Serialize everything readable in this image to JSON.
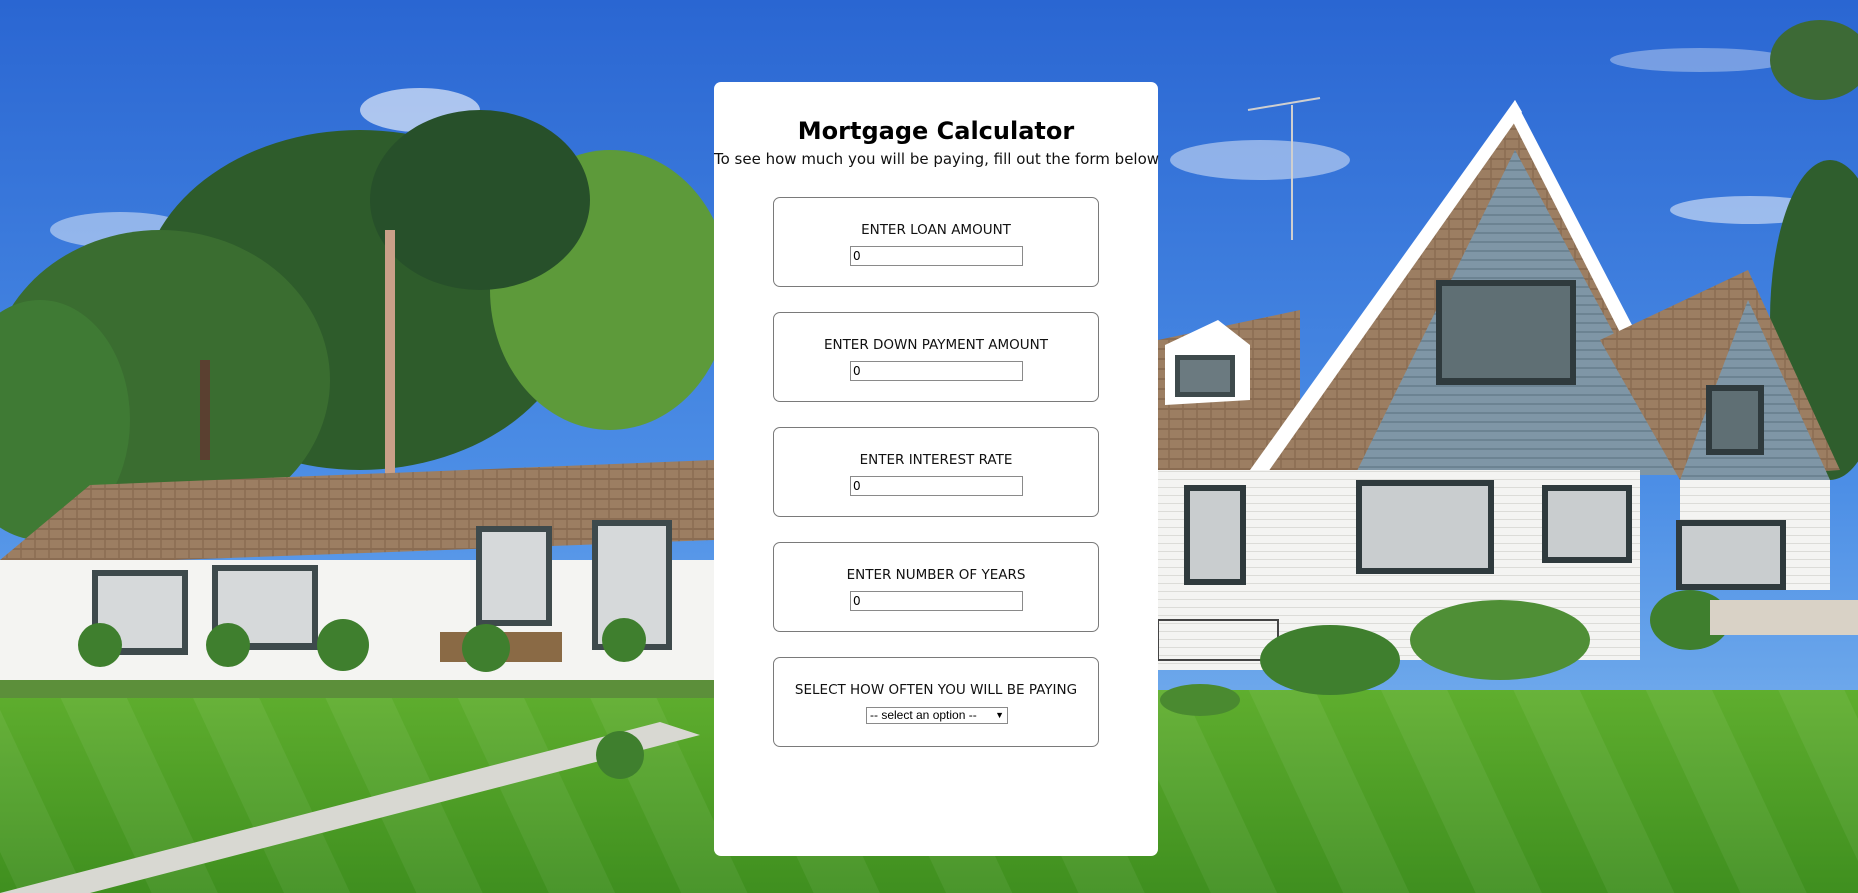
{
  "calculator": {
    "title": "Mortgage Calculator",
    "subtitle": "To see how much you will be paying, fill out the form below",
    "loan_amount": {
      "label": "ENTER LOAN AMOUNT",
      "value": "0"
    },
    "down_payment": {
      "label": "ENTER DOWN PAYMENT AMOUNT",
      "value": "0"
    },
    "interest_rate": {
      "label": "ENTER INTEREST RATE",
      "value": "0"
    },
    "years": {
      "label": "ENTER NUMBER OF YEARS",
      "value": "0"
    },
    "frequency": {
      "label": "SELECT HOW OFTEN YOU WILL BE PAYING",
      "selected": "-- select an option --",
      "arrow_icon": "triangle-down"
    }
  },
  "background": {
    "description_icon": "house-photo",
    "colors": {
      "sky_top": "#2f6fd6",
      "sky_bottom": "#7fb3ee",
      "lawn": "#4a9a26",
      "house_wall": "#f3f3f1",
      "siding": "#7d94a3",
      "roof": "#9a7b5f",
      "trees": "#2d5a2a"
    }
  }
}
